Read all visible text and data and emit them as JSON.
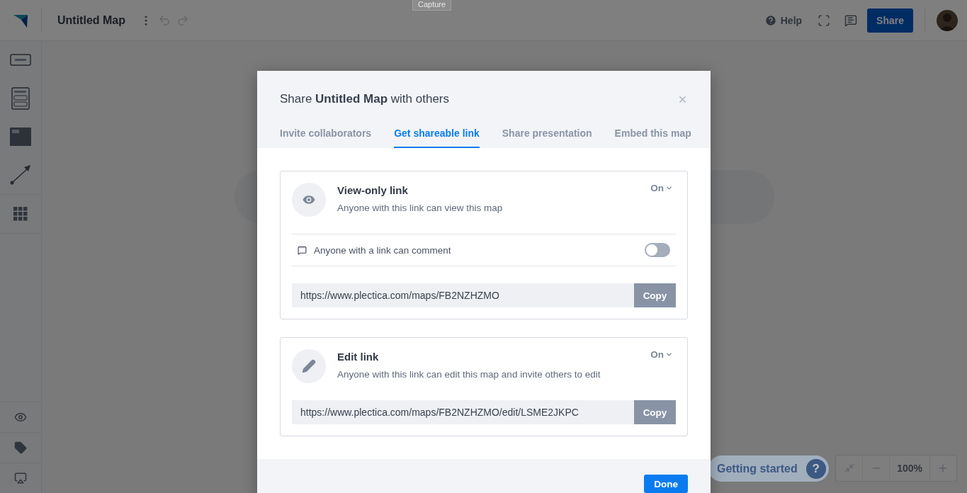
{
  "app": {
    "title": "Untitled Map",
    "help": "Help",
    "share": "Share",
    "capture": "Capture"
  },
  "getting_started": {
    "label": "Getting started",
    "badge": "?"
  },
  "zoom": {
    "level_text": "100%"
  },
  "dialog": {
    "title": "Share **Untitled Map** with others",
    "tabs": [
      {
        "label": "Invite collaborators",
        "selected": false
      },
      {
        "label": "Get shareable link",
        "selected": true
      },
      {
        "label": "Share presentation",
        "selected": false
      },
      {
        "label": "Embed this map",
        "selected": false
      }
    ],
    "links": [
      {
        "kind": "view",
        "title": "View-only link",
        "description": "Anyone with this link can view this map",
        "status": "On",
        "comment_option": {
          "label": "Anyone with a link can comment",
          "on": false
        },
        "url": "https://www.plectica.com/maps/FB2NZHZMO",
        "copy": "Copy"
      },
      {
        "kind": "edit",
        "title": "Edit link",
        "description": "Anyone with this link can edit this map and invite others to edit",
        "status": "On",
        "url": "https://www.plectica.com/maps/FB2NZHZMO/edit/LSME2JKPC",
        "copy": "Copy"
      }
    ],
    "done": "Done"
  }
}
